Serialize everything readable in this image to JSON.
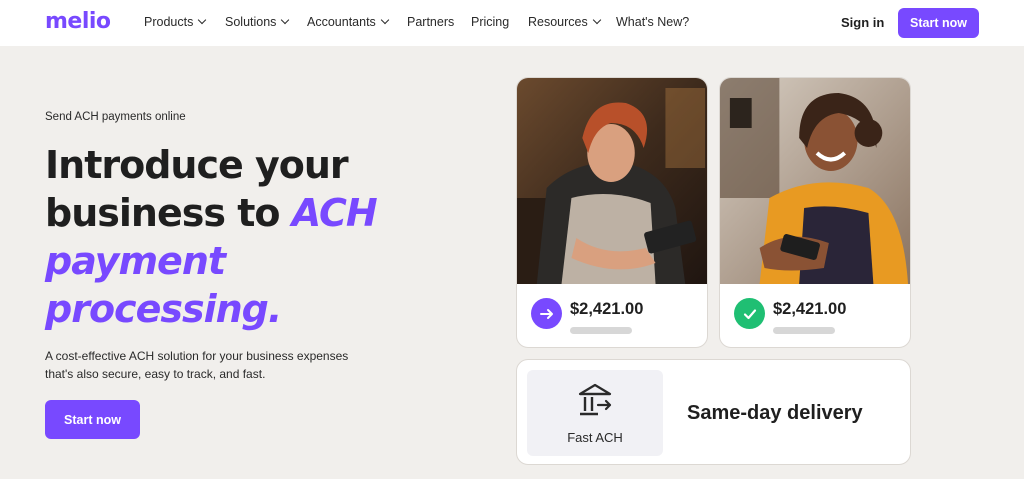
{
  "brand": {
    "logo": "melio",
    "accent_color": "#7849ff"
  },
  "nav": {
    "items": [
      {
        "label": "Products",
        "dropdown": true
      },
      {
        "label": "Solutions",
        "dropdown": true
      },
      {
        "label": "Accountants",
        "dropdown": true
      },
      {
        "label": "Partners",
        "dropdown": false
      },
      {
        "label": "Pricing",
        "dropdown": false
      },
      {
        "label": "Resources",
        "dropdown": true
      },
      {
        "label": "What's New?",
        "dropdown": false
      }
    ],
    "sign_in": "Sign in",
    "cta": "Start now"
  },
  "hero": {
    "eyebrow": "Send ACH payments online",
    "headline_part1": "Introduce your business to ",
    "headline_accent": "ACH payment processing.",
    "subtext": "A cost-effective ACH solution for your business expenses that's also secure, easy to track, and fast.",
    "cta": "Start now"
  },
  "cards": [
    {
      "amount": "$2,421.00",
      "status_icon": "arrow-right-icon",
      "status_color": "#7849ff"
    },
    {
      "amount": "$2,421.00",
      "status_icon": "check-icon",
      "status_color": "#1fbf73"
    }
  ],
  "feature": {
    "icon": "bank-transfer-icon",
    "label": "Fast ACH",
    "title": "Same-day delivery"
  }
}
